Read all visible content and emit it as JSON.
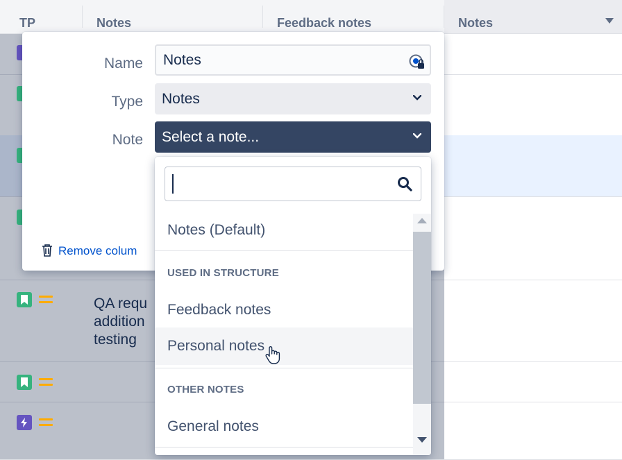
{
  "table": {
    "columns": [
      {
        "label": "TP"
      },
      {
        "label": "Notes"
      },
      {
        "label": "Feedback notes"
      },
      {
        "label": "Notes"
      }
    ],
    "rows": [
      {
        "type_icon": "green-bookmark-icon",
        "text": ""
      },
      {
        "type_icon": "green-bookmark-icon",
        "text": ""
      },
      {
        "type_icon": "green-bookmark-icon",
        "text": ""
      },
      {
        "type_icon": "green-bookmark-icon",
        "text": ""
      },
      {
        "type_icon": "green-bookmark-icon",
        "text": "QA requ\naddition\ntesting"
      },
      {
        "type_icon": "green-bookmark-icon",
        "text": ""
      },
      {
        "type_icon": "purple-lightning-icon",
        "text": ""
      }
    ]
  },
  "config_panel": {
    "name_label": "Name",
    "name_value": "Notes",
    "type_label": "Type",
    "type_value": "Notes",
    "note_label": "Note",
    "note_placeholder": "Select a note...",
    "remove_label": "Remove colum"
  },
  "dropdown": {
    "search_value": "",
    "default_option": "Notes (Default)",
    "groups": [
      {
        "heading": "USED IN STRUCTURE",
        "options": [
          "Feedback notes",
          "Personal notes"
        ]
      },
      {
        "heading": "OTHER NOTES",
        "options": [
          "General notes"
        ]
      }
    ],
    "hovered_option": "Personal notes"
  },
  "colors": {
    "accent_dark": "#344563",
    "link": "#0052cc",
    "task_green": "#36b37e",
    "task_purple": "#6554c0",
    "priority": "#ffab00"
  }
}
